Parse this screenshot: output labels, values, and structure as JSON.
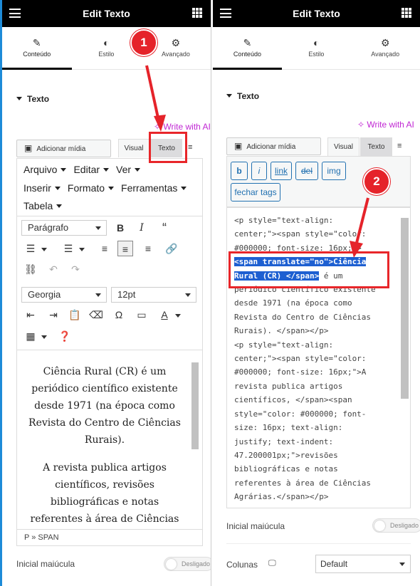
{
  "left": {
    "title": "Edit Texto",
    "tabs": [
      "Conteúdo",
      "Estilo",
      "Avançado"
    ],
    "section": "Texto",
    "write_ai": "Write with AI",
    "add_media": "Adicionar mídia",
    "mode_visual": "Visual",
    "mode_text": "Texto",
    "menus": [
      "Arquivo",
      "Editar",
      "Ver",
      "Inserir",
      "Formato",
      "Ferramentas",
      "Tabela"
    ],
    "format_select": "Parágrafo",
    "font_select": "Georgia",
    "size_select": "12pt",
    "paragraph1": "Ciência Rural (CR) é um periódico científico existente desde 1971 (na época como Revista do Centro de Ciências Rurais).",
    "paragraph2": "A revista publica artigos científicos, revisões bibliográficas e notas referentes à área de Ciências",
    "status": "P » SPAN",
    "toggle_label": "Inicial maiúcula",
    "toggle_state": "Desligado",
    "badge": "1"
  },
  "right": {
    "title": "Edit Texto",
    "tabs": [
      "Conteúdo",
      "Estilo",
      "Avançado"
    ],
    "section": "Texto",
    "write_ai": "Write with AI",
    "add_media": "Adicionar mídia",
    "mode_visual": "Visual",
    "mode_text": "Texto",
    "quicktags": [
      "b",
      "i",
      "link",
      "del",
      "img",
      "fechar tags"
    ],
    "code_lines": [
      "<p style=\"text-align:",
      "center;\"><span style=\"color:",
      "#000000; font-size: 16px;\">",
      "",
      "",
      "periódico científico existente",
      "desde 1971 (na época como",
      "Revista do Centro de Ciências",
      "Rurais). </span></p>",
      "<p style=\"text-align:",
      "center;\"><span style=\"color:",
      "#000000; font-size: 16px;\">A",
      "revista publica artigos",
      "científicos, </span><span",
      "style=\"color: #000000; font-",
      "size: 16px; text-align:",
      "justify; text-indent:",
      "47.200001px;\">revisões",
      "bibliográficas e notas",
      "referentes à área de Ciências",
      "Agrárias.</span></p>"
    ],
    "hl_line1": "<span translate=\"no\">Ciência",
    "hl_line2a": "Rural (CR) </span>",
    "hl_line2b": " é um",
    "toggle_label": "Inicial maiúcula",
    "toggle_state": "Desligado",
    "columns_label": "Colunas",
    "columns_value": "Default",
    "badge": "2"
  }
}
